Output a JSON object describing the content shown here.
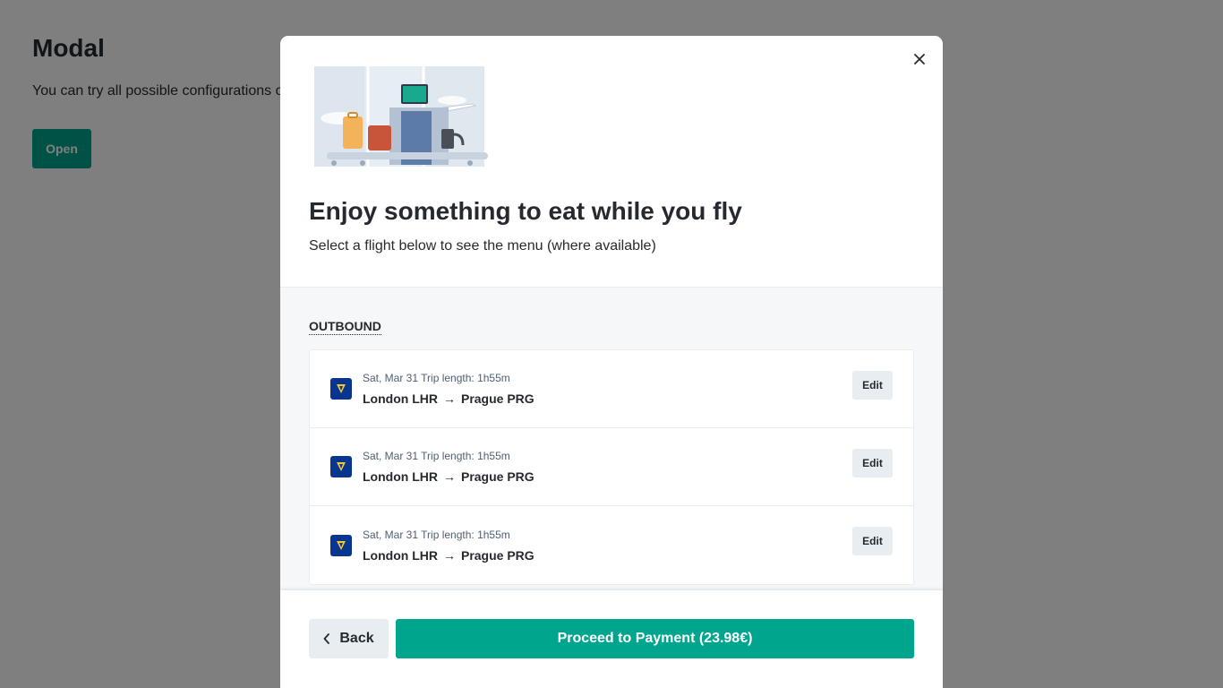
{
  "page": {
    "title": "Modal",
    "description": "You can try all possible configurations of",
    "open_label": "Open"
  },
  "modal": {
    "close_icon": "close-icon",
    "illustration": "airport-baggage-illustration",
    "title": "Enjoy something to eat while you fly",
    "description": "Select a flight below to see the menu (where available)",
    "section_label": "Outbound",
    "trips": [
      {
        "date": "Sat, Mar 31",
        "length": "Trip length: 1h55m",
        "from": "London LHR",
        "to": "Prague PRG",
        "edit_label": "Edit",
        "carrier_icon": "ryanair-logo-icon"
      },
      {
        "date": "Sat, Mar 31",
        "length": "Trip length: 1h55m",
        "from": "London LHR",
        "to": "Prague PRG",
        "edit_label": "Edit",
        "carrier_icon": "ryanair-logo-icon"
      },
      {
        "date": "Sat, Mar 31",
        "length": "Trip length: 1h55m",
        "from": "London LHR",
        "to": "Prague PRG",
        "edit_label": "Edit",
        "carrier_icon": "ryanair-logo-icon"
      }
    ],
    "footer": {
      "back_label": "Back",
      "proceed_label": "Proceed to Payment (23.98€)"
    }
  },
  "colors": {
    "accent": "#00a58e",
    "text": "#252a31",
    "muted": "#4f5e71",
    "section_bg": "#f5f7f9",
    "carrier": "#073590"
  }
}
